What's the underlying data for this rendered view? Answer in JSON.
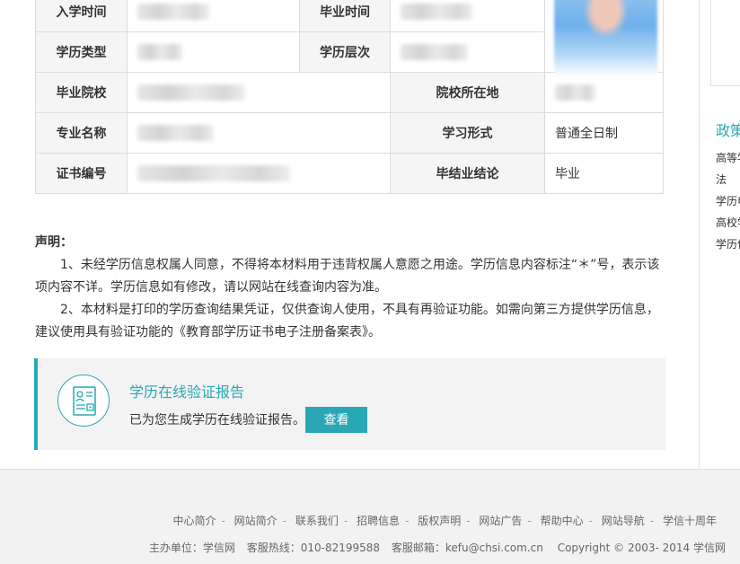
{
  "table": {
    "rows": [
      {
        "l1": "入学时间",
        "l2": "毕业时间"
      },
      {
        "l1": "学历类型",
        "l2": "学历层次"
      },
      {
        "l1": "毕业院校",
        "l2": "院校所在地"
      },
      {
        "l1": "专业名称",
        "l2": "学习形式",
        "v2": "普通全日制"
      },
      {
        "l1": "证书编号",
        "l2": "毕结业结论",
        "v2": "毕业"
      }
    ]
  },
  "declaration": {
    "head": "声明：",
    "p1": "1、未经学历信息权属人同意，不得将本材料用于违背权属人意愿之用途。学历信息内容标注“＊”号，表示该项内容不详。学历信息如有修改，请以网站在线查询内容为准。",
    "p2": "2、本材料是打印的学历查询结果凭证，仅供查询人使用，不具有再验证功能。如需向第三方提供学历信息，建议使用具有验证功能的《教育部学历证书电子注册备案表》。"
  },
  "report": {
    "title": "学历在线验证报告",
    "desc": "已为您生成学历在线验证报告。",
    "button": "查看",
    "icon": "report-document-icon",
    "accent": "#2aa7b5"
  },
  "sidebar": {
    "title": "政策",
    "items": [
      "高等学",
      "法",
      "学历电",
      "高校学",
      "学历信"
    ]
  },
  "footer": {
    "links": [
      "中心简介",
      "网站简介",
      "联系我们",
      "招聘信息",
      "版权声明",
      "网站广告",
      "帮助中心",
      "网站导航",
      "学信十周年"
    ],
    "host": "主办单位：学信网",
    "hotline": "客服热线：010-82199588",
    "email": "客服邮箱：kefu@chsi.com.cn",
    "copyright": "Copyright © 2003- 2014 学信网"
  }
}
